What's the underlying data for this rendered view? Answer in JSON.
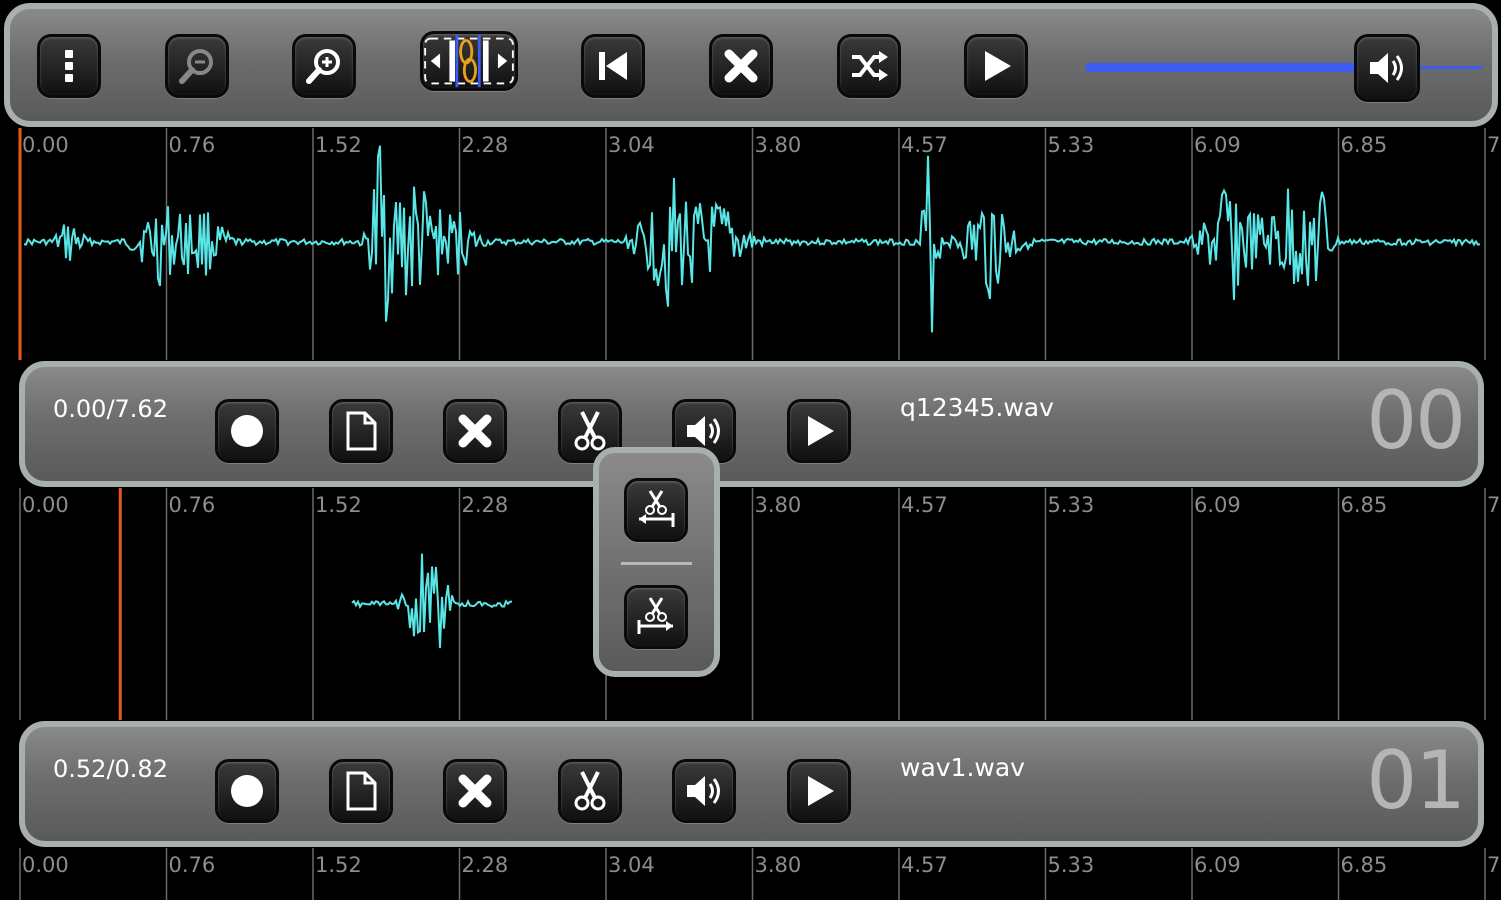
{
  "toolbar": {
    "buttons": [
      {
        "name": "menu-button",
        "icon": "menu-dots-icon"
      },
      {
        "name": "zoom-out-button",
        "icon": "zoom-out-icon"
      },
      {
        "name": "zoom-in-button",
        "icon": "zoom-in-icon"
      },
      {
        "name": "link-tracks-button",
        "icon": "link-icon"
      },
      {
        "name": "skip-to-start-button",
        "icon": "skip-back-icon"
      },
      {
        "name": "delete-button",
        "icon": "close-icon"
      },
      {
        "name": "shuffle-button",
        "icon": "shuffle-icon"
      },
      {
        "name": "play-all-button",
        "icon": "play-icon"
      }
    ],
    "volume": {
      "level": 0.76,
      "icon": "speaker-icon",
      "color": "#3f5cf2"
    }
  },
  "timeline_ticks": [
    "0.00",
    "0.76",
    "1.52",
    "2.28",
    "3.04",
    "3.80",
    "4.57",
    "5.33",
    "6.09",
    "6.85",
    "7."
  ],
  "tracks": [
    {
      "time": "0.00/7.62",
      "filename": "q12345.wav",
      "number": "00",
      "playhead": 0.0
    },
    {
      "time": "0.52/0.82",
      "filename": "wav1.wav",
      "number": "01",
      "playhead": 0.52
    }
  ],
  "track_buttons": [
    {
      "name": "record-button",
      "icon": "record-icon"
    },
    {
      "name": "new-file-button",
      "icon": "document-icon"
    },
    {
      "name": "delete-track-button",
      "icon": "close-icon"
    },
    {
      "name": "cut-button",
      "icon": "scissors-icon"
    },
    {
      "name": "volume-button",
      "icon": "speaker-icon"
    },
    {
      "name": "play-track-button",
      "icon": "play-icon"
    }
  ],
  "cut_popup": {
    "items": [
      {
        "name": "trim-start-button",
        "icon": "trim-left-icon"
      },
      {
        "name": "trim-end-button",
        "icon": "trim-right-icon"
      }
    ]
  },
  "colors": {
    "waveform": "#5ae6e6",
    "playhead": "#e85a1a",
    "grid": "#6a6a6a",
    "tick_label": "#8c8c8c"
  }
}
